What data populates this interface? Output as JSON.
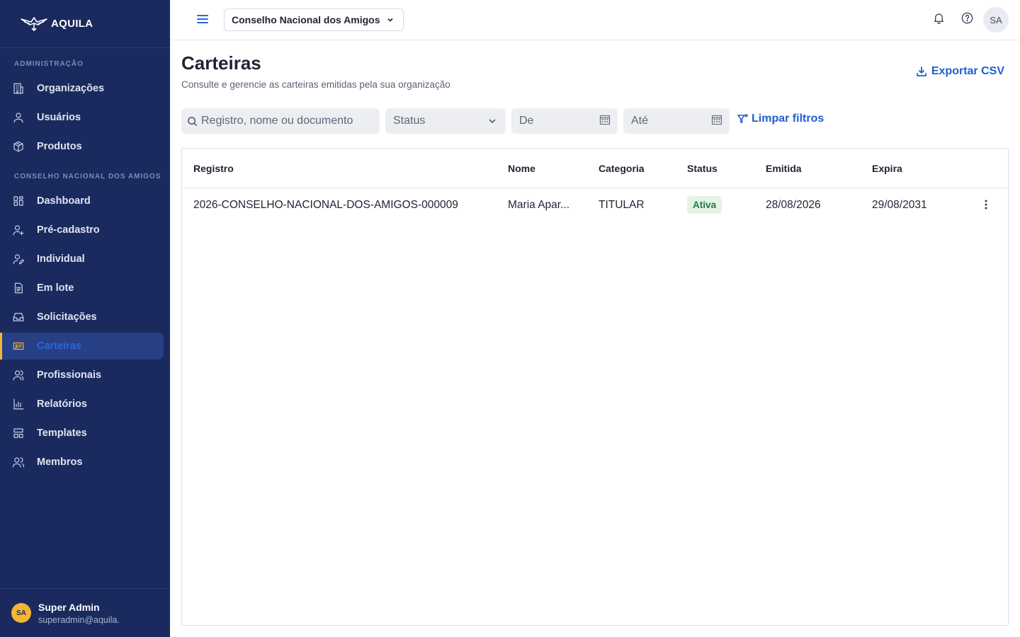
{
  "brand": {
    "name": "AQUILA"
  },
  "sidebar": {
    "section_admin": "ADMINISTRAÇÃO",
    "section_org": "CONSELHO NACIONAL DOS AMIGOS",
    "admin_items": [
      {
        "label": "Organizações",
        "icon": "building-icon"
      },
      {
        "label": "Usuários",
        "icon": "user-icon"
      },
      {
        "label": "Produtos",
        "icon": "box-icon"
      }
    ],
    "org_items": [
      {
        "label": "Dashboard",
        "icon": "grid-icon"
      },
      {
        "label": "Pré-cadastro",
        "icon": "user-plus-icon"
      },
      {
        "label": "Individual",
        "icon": "user-edit-icon"
      },
      {
        "label": "Em lote",
        "icon": "file-list-icon"
      },
      {
        "label": "Solicitações",
        "icon": "inbox-icon"
      },
      {
        "label": "Carteiras",
        "icon": "id-card-icon",
        "active": true
      },
      {
        "label": "Profissionais",
        "icon": "users-icon"
      },
      {
        "label": "Relatórios",
        "icon": "bar-chart-icon"
      },
      {
        "label": "Templates",
        "icon": "layout-icon"
      },
      {
        "label": "Membros",
        "icon": "members-icon"
      }
    ],
    "user": {
      "initials": "SA",
      "name": "Super Admin",
      "email": "superadmin@aquila."
    }
  },
  "topbar": {
    "org_selector": "Conselho Nacional dos Amigos",
    "avatar_initials": "SA"
  },
  "page": {
    "title": "Carteiras",
    "subtitle": "Consulte e gerencie as carteiras emitidas pela sua organização",
    "export_label": "Exportar CSV"
  },
  "filters": {
    "search_placeholder": "Registro, nome ou documento",
    "status_placeholder": "Status",
    "from_placeholder": "De",
    "to_placeholder": "Até",
    "clear_label": "Limpar filtros"
  },
  "table": {
    "columns": [
      "Registro",
      "Nome",
      "Categoria",
      "Status",
      "Emitida",
      "Expira"
    ],
    "rows": [
      {
        "registro": "2026-CONSELHO-NACIONAL-DOS-AMIGOS-000009",
        "nome": "Maria Apar...",
        "categoria": "TITULAR",
        "status": "Ativa",
        "emitida": "28/08/2026",
        "expira": "29/08/2031"
      }
    ]
  },
  "colors": {
    "sidebar_bg": "#1a2a5e",
    "accent": "#1f5fcf",
    "active_marker": "#f2b632",
    "status_active_bg": "#e4f3e7",
    "status_active_text": "#1f7a3a"
  }
}
